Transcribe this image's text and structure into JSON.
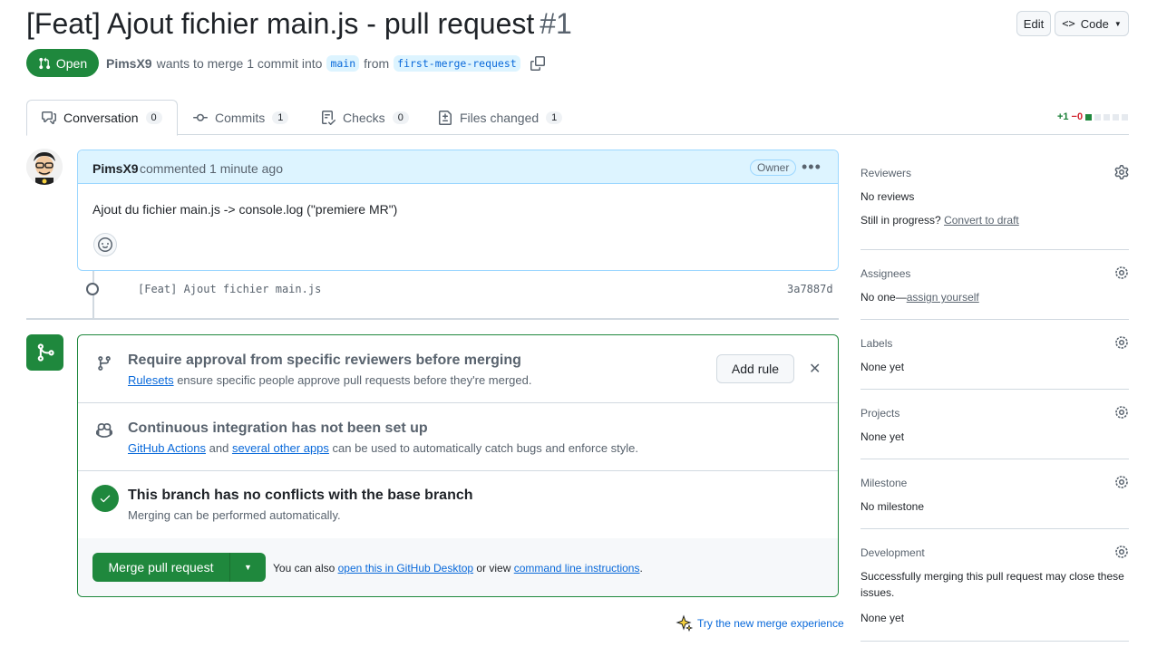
{
  "header": {
    "title": "[Feat] Ajout fichier main.js - pull request",
    "number": "#1",
    "edit_label": "Edit",
    "code_label": "Code",
    "state": "Open",
    "author": "PimsX9",
    "merge_text_a": "wants to merge 1 commit into",
    "base_branch": "main",
    "merge_text_b": "from",
    "head_branch": "first-merge-request"
  },
  "tabs": [
    {
      "label": "Conversation",
      "count": "0"
    },
    {
      "label": "Commits",
      "count": "1"
    },
    {
      "label": "Checks",
      "count": "0"
    },
    {
      "label": "Files changed",
      "count": "1"
    }
  ],
  "diffstat": {
    "additions": "+1",
    "deletions": "−0"
  },
  "comment": {
    "author": "PimsX9",
    "action": "commented 1 minute ago",
    "role": "Owner",
    "body": "Ajout du fichier main.js -> console.log (\"premiere MR\")"
  },
  "commit": {
    "message": "[Feat] Ajout fichier main.js",
    "sha": "3a7887d"
  },
  "merge": {
    "rules_title": "Require approval from specific reviewers before merging",
    "rules_link": "Rulesets",
    "rules_text": "ensure specific people approve pull requests before they're merged.",
    "add_rule_label": "Add rule",
    "ci_title": "Continuous integration has not been set up",
    "ci_link_a": "GitHub Actions",
    "ci_and": "and",
    "ci_link_b": "several other apps",
    "ci_text": "can be used to automatically catch bugs and enforce style.",
    "conflict_title": "This branch has no conflicts with the base branch",
    "conflict_sub": "Merging can be performed automatically.",
    "merge_button": "Merge pull request",
    "alt_a": "You can also",
    "alt_link_a": "open this in GitHub Desktop",
    "alt_b": "or view",
    "alt_link_b": "command line instructions",
    "alt_c": ".",
    "try_new": "Try the new merge experience"
  },
  "sidebar": {
    "reviewers": {
      "heading": "Reviewers",
      "value": "No reviews",
      "progress_text": "Still in progress?",
      "progress_link": "Convert to draft"
    },
    "assignees": {
      "heading": "Assignees",
      "value": "No one—",
      "link": "assign yourself"
    },
    "labels": {
      "heading": "Labels",
      "value": "None yet"
    },
    "projects": {
      "heading": "Projects",
      "value": "None yet"
    },
    "milestone": {
      "heading": "Milestone",
      "value": "No milestone"
    },
    "development": {
      "heading": "Development",
      "value_line1": "Successfully merging this pull request may close these",
      "value_line2": "issues.",
      "value_b": "None yet"
    }
  },
  "colors": {
    "accent_green": "#1f883d",
    "link_blue": "#0969da",
    "comment_header": "#ddf4ff"
  }
}
